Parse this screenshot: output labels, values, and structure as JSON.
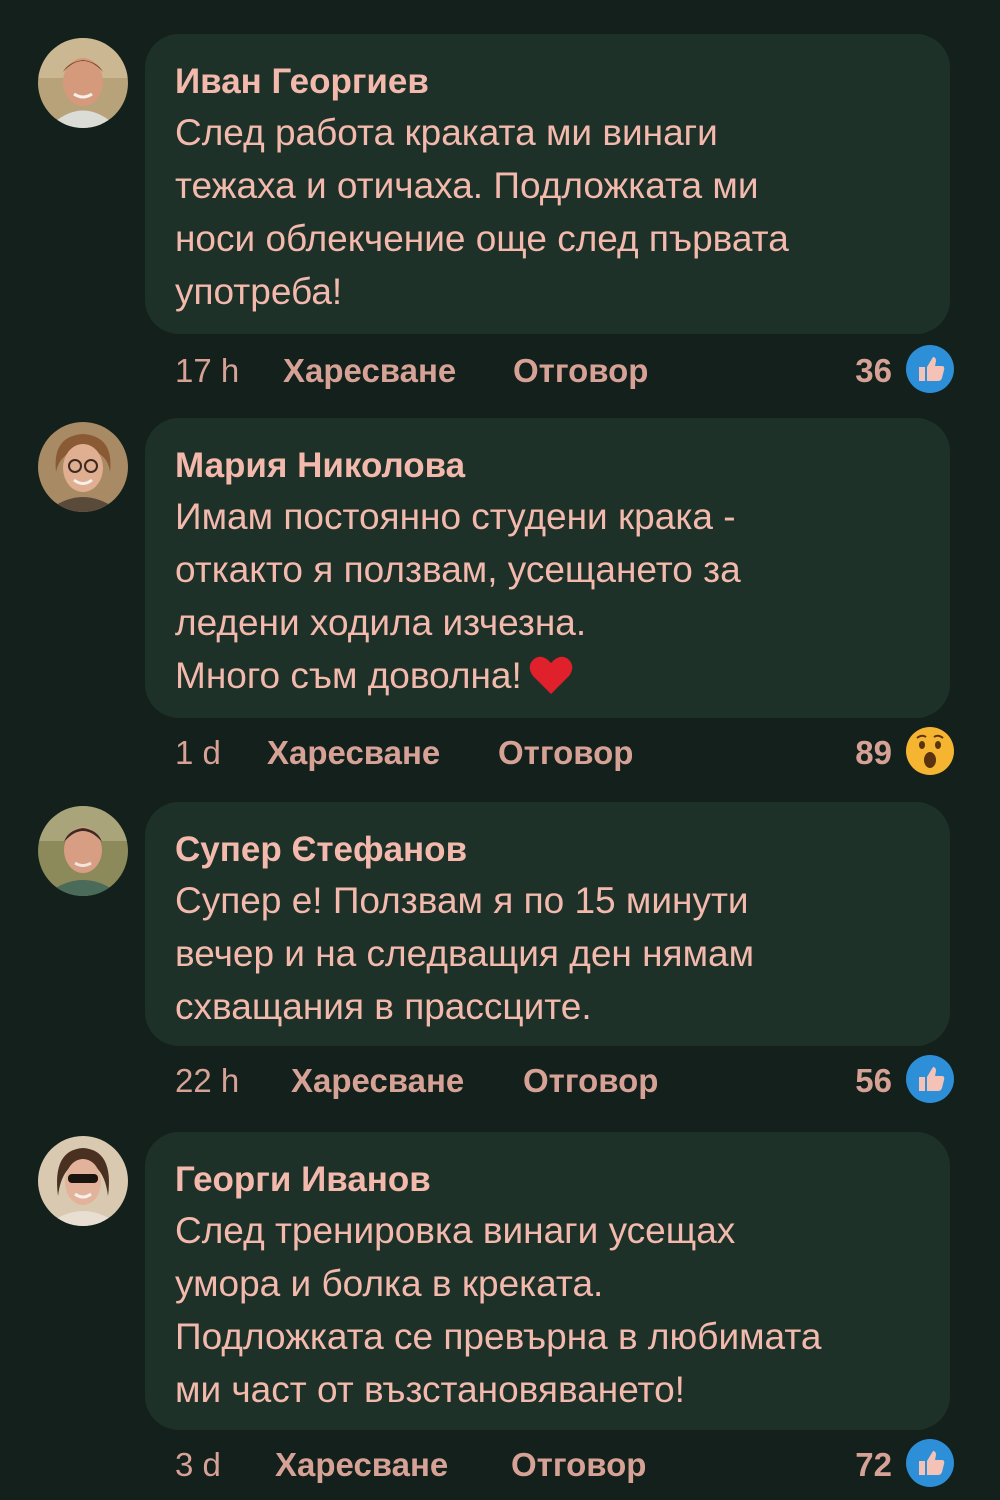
{
  "comments": [
    {
      "author": "Иван Георгиев",
      "lines": [
        "След работа краката ми винаги",
        "тежаха и отичаха. Подложката ми",
        "носи облекчение още след първата",
        "употреба!"
      ],
      "time": "17 h",
      "like_label": "Харесване",
      "reply_label": "Отговор",
      "reaction_count": "36",
      "reaction_icon": "thumbs-up-icon"
    },
    {
      "author": "Мария Николова",
      "lines": [
        "Имам постоянно студени крака -",
        "откакто я ползвам, усещането за",
        "ледени ходила изчезна.",
        "Много съм доволна!"
      ],
      "time": "1 d",
      "like_label": "Харесване",
      "reply_label": "Отговор",
      "reaction_count": "89",
      "reaction_icon": "wow-face-icon"
    },
    {
      "author": "Супер Єтефанов",
      "lines": [
        "Супер е! Ползвам я по 15 минути",
        "вечер и на следващия ден нямам",
        "схващания в прассците."
      ],
      "time": "22 h",
      "like_label": "Харесване",
      "reply_label": "Отговор",
      "reaction_count": "56",
      "reaction_icon": "thumbs-up-icon"
    },
    {
      "author": "Георги Иванов",
      "lines": [
        "След тренировка винаги усещах",
        "умора и болка в креката.",
        "Подложката се превърна в любимата",
        "ми част от възстановяването!"
      ],
      "time": "3 d",
      "like_label": "Харесване",
      "reply_label": "Отговор",
      "reaction_count": "72",
      "reaction_icon": "thumbs-up-icon"
    }
  ],
  "colors": {
    "background": "#13201b",
    "bubble": "#1e3128",
    "text": "#f3b9ad",
    "like_blue": "#2d8fd8",
    "wow_yellow": "#f5b531",
    "heart_red": "#e0202a"
  }
}
